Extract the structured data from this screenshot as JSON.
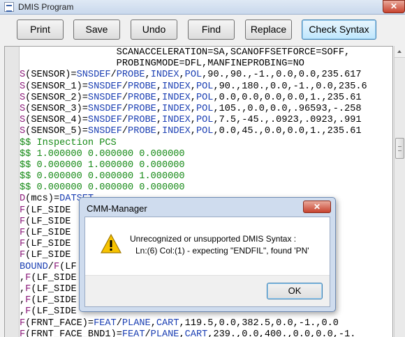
{
  "window": {
    "title": "DMIS Program",
    "close_glyph": "✕"
  },
  "toolbar": {
    "buttons": [
      "Print",
      "Save",
      "Undo",
      "Find",
      "Replace",
      "Check Syntax"
    ],
    "active_button": "Check Syntax"
  },
  "editor": {
    "lines": [
      [
        {
          "t": "                 SCANACCELERATION=SA,SCANOFFSETFORCE=SOFF,",
          "c": "blk"
        }
      ],
      [
        {
          "t": "                 PROBINGMODE=DFL,MANFINEPROBING=NO",
          "c": "blk"
        }
      ],
      [
        {
          "t": "S",
          "c": "mag"
        },
        {
          "t": "(SENSOR)=",
          "c": "blk"
        },
        {
          "t": "SNSDEF",
          "c": "blu"
        },
        {
          "t": "/",
          "c": "blk"
        },
        {
          "t": "PROBE",
          "c": "blu"
        },
        {
          "t": ",",
          "c": "blk"
        },
        {
          "t": "INDEX",
          "c": "blu"
        },
        {
          "t": ",",
          "c": "blk"
        },
        {
          "t": "POL",
          "c": "blu"
        },
        {
          "t": ",90.,90.,-1.,0.0,0.0,235.617",
          "c": "blk"
        }
      ],
      [
        {
          "t": "S",
          "c": "mag"
        },
        {
          "t": "(SENSOR_1)=",
          "c": "blk"
        },
        {
          "t": "SNSDEF",
          "c": "blu"
        },
        {
          "t": "/",
          "c": "blk"
        },
        {
          "t": "PROBE",
          "c": "blu"
        },
        {
          "t": ",",
          "c": "blk"
        },
        {
          "t": "INDEX",
          "c": "blu"
        },
        {
          "t": ",",
          "c": "blk"
        },
        {
          "t": "POL",
          "c": "blu"
        },
        {
          "t": ",90.,180.,0.0,-1.,0.0,235.6",
          "c": "blk"
        }
      ],
      [
        {
          "t": "S",
          "c": "mag"
        },
        {
          "t": "(SENSOR_2)=",
          "c": "blk"
        },
        {
          "t": "SNSDEF",
          "c": "blu"
        },
        {
          "t": "/",
          "c": "blk"
        },
        {
          "t": "PROBE",
          "c": "blu"
        },
        {
          "t": ",",
          "c": "blk"
        },
        {
          "t": "INDEX",
          "c": "blu"
        },
        {
          "t": ",",
          "c": "blk"
        },
        {
          "t": "POL",
          "c": "blu"
        },
        {
          "t": ",0.0,0.0,0.0,0.0,1.,235.61",
          "c": "blk"
        }
      ],
      [
        {
          "t": "S",
          "c": "mag"
        },
        {
          "t": "(SENSOR_3)=",
          "c": "blk"
        },
        {
          "t": "SNSDEF",
          "c": "blu"
        },
        {
          "t": "/",
          "c": "blk"
        },
        {
          "t": "PROBE",
          "c": "blu"
        },
        {
          "t": ",",
          "c": "blk"
        },
        {
          "t": "INDEX",
          "c": "blu"
        },
        {
          "t": ",",
          "c": "blk"
        },
        {
          "t": "POL",
          "c": "blu"
        },
        {
          "t": ",105.,0.0,0.0,.96593,-.258",
          "c": "blk"
        }
      ],
      [
        {
          "t": "S",
          "c": "mag"
        },
        {
          "t": "(SENSOR_4)=",
          "c": "blk"
        },
        {
          "t": "SNSDEF",
          "c": "blu"
        },
        {
          "t": "/",
          "c": "blk"
        },
        {
          "t": "PROBE",
          "c": "blu"
        },
        {
          "t": ",",
          "c": "blk"
        },
        {
          "t": "INDEX",
          "c": "blu"
        },
        {
          "t": ",",
          "c": "blk"
        },
        {
          "t": "POL",
          "c": "blu"
        },
        {
          "t": ",7.5,-45.,.0923,.0923,.991",
          "c": "blk"
        }
      ],
      [
        {
          "t": "S",
          "c": "mag"
        },
        {
          "t": "(SENSOR_5)=",
          "c": "blk"
        },
        {
          "t": "SNSDEF",
          "c": "blu"
        },
        {
          "t": "/",
          "c": "blk"
        },
        {
          "t": "PROBE",
          "c": "blu"
        },
        {
          "t": ",",
          "c": "blk"
        },
        {
          "t": "INDEX",
          "c": "blu"
        },
        {
          "t": ",",
          "c": "blk"
        },
        {
          "t": "POL",
          "c": "blu"
        },
        {
          "t": ",0.0,45.,0.0,0.0,1.,235.61",
          "c": "blk"
        }
      ],
      [
        {
          "t": "$$ Inspection PCS",
          "c": "grn"
        }
      ],
      [
        {
          "t": "$$ 1.000000 0.000000 0.000000",
          "c": "grn"
        }
      ],
      [
        {
          "t": "$$ 0.000000 1.000000 0.000000",
          "c": "grn"
        }
      ],
      [
        {
          "t": "$$ 0.000000 0.000000 1.000000",
          "c": "grn"
        }
      ],
      [
        {
          "t": "$$ 0.000000 0.000000 0.000000",
          "c": "grn"
        }
      ],
      [
        {
          "t": "D",
          "c": "mag"
        },
        {
          "t": "(mcs)=",
          "c": "blk"
        },
        {
          "t": "DATSET",
          "c": "blu"
        }
      ],
      [
        {
          "t": "F",
          "c": "mag"
        },
        {
          "t": "(LF_SIDE                                 .,0.0,0.0",
          "c": "blk"
        }
      ],
      [
        {
          "t": "F",
          "c": "mag"
        },
        {
          "t": "(LF_SIDE                                 5.,0.0,0.0",
          "c": "blk"
        }
      ],
      [
        {
          "t": "F",
          "c": "mag"
        },
        {
          "t": "(LF_SIDE                                 0.0,1.,0.0",
          "c": "blk"
        }
      ],
      [
        {
          "t": "F",
          "c": "mag"
        },
        {
          "t": "(LF_SIDE                                 0.0,0.0,-1",
          "c": "blk"
        }
      ],
      [
        {
          "t": "F",
          "c": "mag"
        },
        {
          "t": "(LF_SIDE                                 9.,0.0,-1.",
          "c": "blk"
        }
      ],
      [
        {
          "t": "BOUND",
          "c": "blu"
        },
        {
          "t": "/",
          "c": "blk"
        },
        {
          "t": "F",
          "c": "mag"
        },
        {
          "t": "(LF",
          "c": "blk"
        }
      ],
      [
        {
          "t": ",",
          "c": "blk"
        },
        {
          "t": "F",
          "c": "mag"
        },
        {
          "t": "(LF_SIDE",
          "c": "blk"
        }
      ],
      [
        {
          "t": ",",
          "c": "blk"
        },
        {
          "t": "F",
          "c": "mag"
        },
        {
          "t": "(LF_SIDE",
          "c": "blk"
        }
      ],
      [
        {
          "t": ",",
          "c": "blk"
        },
        {
          "t": "F",
          "c": "mag"
        },
        {
          "t": "(LF_SIDE",
          "c": "blk"
        }
      ],
      [
        {
          "t": ",",
          "c": "blk"
        },
        {
          "t": "F",
          "c": "mag"
        },
        {
          "t": "(LF_SIDE",
          "c": "blk"
        }
      ],
      [
        {
          "t": "F",
          "c": "mag"
        },
        {
          "t": "(FRNT_FACE)=",
          "c": "blk"
        },
        {
          "t": "FEAT",
          "c": "blu"
        },
        {
          "t": "/",
          "c": "blk"
        },
        {
          "t": "PLANE",
          "c": "blu"
        },
        {
          "t": ",",
          "c": "blk"
        },
        {
          "t": "CART",
          "c": "blu"
        },
        {
          "t": ",119.5,0.0,382.5,0.0,-1.,0.0",
          "c": "blk"
        }
      ],
      [
        {
          "t": "F",
          "c": "mag"
        },
        {
          "t": "(FRNT_FACE_BND1)=",
          "c": "blk"
        },
        {
          "t": "FEAT",
          "c": "blu"
        },
        {
          "t": "/",
          "c": "blk"
        },
        {
          "t": "PLANE",
          "c": "blu"
        },
        {
          "t": ",",
          "c": "blk"
        },
        {
          "t": "CART",
          "c": "blu"
        },
        {
          "t": ",239.,0.0,400.,0.0,0.0,-1.",
          "c": "blk"
        }
      ]
    ]
  },
  "dialog": {
    "title": "CMM-Manager",
    "close_glyph": "✕",
    "icon": "warning-icon",
    "message_line1": "Unrecognized or unsupported DMIS Syntax :",
    "message_line2": "Ln:(6) Col:(1) - expecting \"ENDFIL\", found 'PN'",
    "ok_label": "OK"
  },
  "colors": {
    "keyword_blue": "#1b3fb3",
    "label_magenta": "#8b1a7a",
    "comment_green": "#168a16",
    "warning_yellow": "#f7c300"
  }
}
